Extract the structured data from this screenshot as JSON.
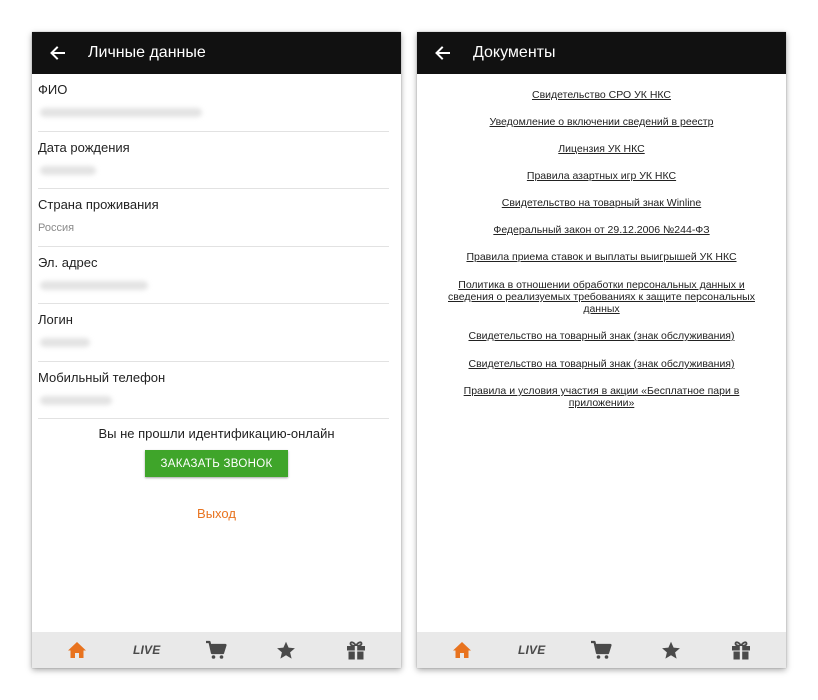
{
  "colors": {
    "appbar": "#111111",
    "accent_orange": "#e8731f",
    "button_green": "#3fa52a",
    "nav_bg": "#e9e9e9",
    "nav_icon": "#4a4a4a"
  },
  "personal": {
    "title": "Личные данные",
    "fields": [
      {
        "label": "ФИО",
        "value": ""
      },
      {
        "label": "Дата рождения",
        "value": ""
      },
      {
        "label": "Страна проживания",
        "value": "Россия"
      },
      {
        "label": "Эл. адрес",
        "value": ""
      },
      {
        "label": "Логин",
        "value": ""
      },
      {
        "label": "Мобильный телефон",
        "value": ""
      }
    ],
    "ident_message": "Вы не прошли идентификацию-онлайн",
    "call_button": "ЗАКАЗАТЬ ЗВОНОК",
    "exit_link": "Выход"
  },
  "documents": {
    "title": "Документы",
    "links": [
      "Свидетельство СРО УК НКС",
      "Уведомление о включении сведений в реестр",
      "Лицензия УК НКС",
      "Правила азартных игр УК НКС",
      "Свидетельство на товарный знак Winline",
      "Федеральный закон от 29.12.2006 №244-ФЗ",
      "Правила приема ставок и выплаты выигрышей УК НКС",
      "Политика в отношении обработки персональных данных и сведения о реализуемых требованиях к защите персональных данных",
      "Свидетельство на товарный знак (знак обслуживания)",
      "Свидетельство на товарный знак (знак обслуживания)",
      "Правила и условия участия в акции «Бесплатное пари в приложении»"
    ]
  },
  "nav": {
    "items": [
      {
        "icon": "home-icon",
        "active": true
      },
      {
        "icon": "live-icon",
        "label": "LIVE"
      },
      {
        "icon": "cart-icon"
      },
      {
        "icon": "star-icon"
      },
      {
        "icon": "gift-icon"
      }
    ]
  }
}
